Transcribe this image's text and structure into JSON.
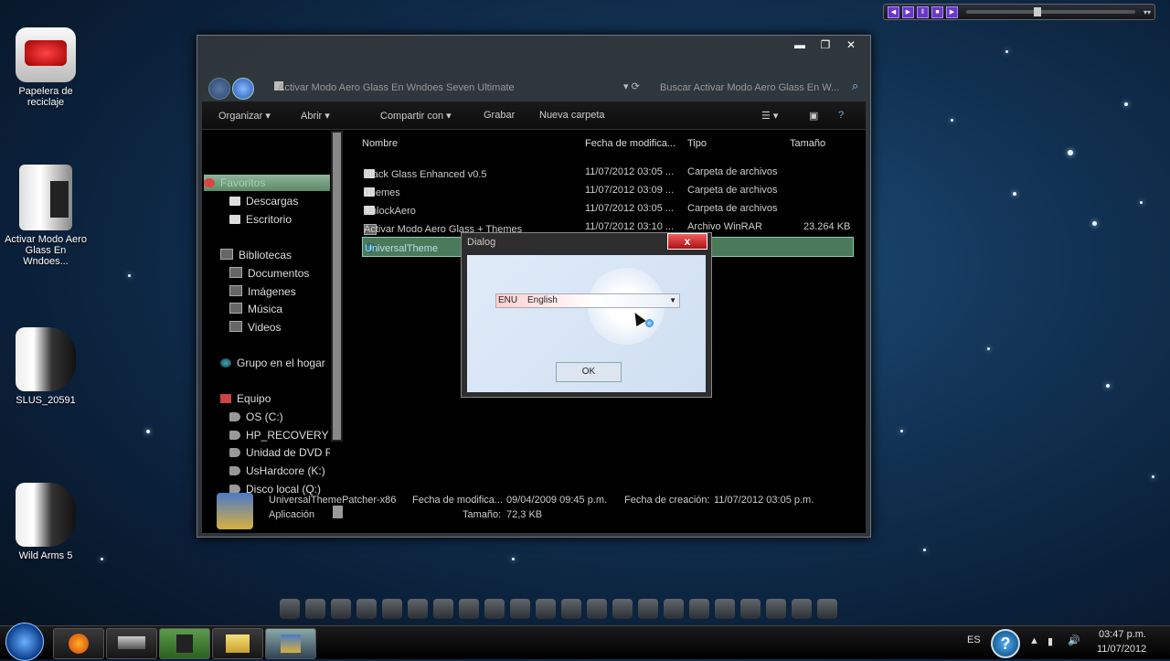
{
  "desktop": {
    "icons": [
      {
        "label": "Papelera de reciclaje",
        "icon": "recycle-bin-icon"
      },
      {
        "label": "Activar Modo Aero Glass En Wndoes...",
        "icon": "winrar-archive-icon"
      },
      {
        "label": "SLUS_20591",
        "icon": "disc-drive-icon"
      },
      {
        "label": "Wild Arms 5",
        "icon": "disc-drive-icon"
      }
    ]
  },
  "explorer": {
    "address": "Activar Modo Aero Glass En Wndoes Seven Ultimate",
    "search_placeholder": "Buscar Activar Modo Aero Glass En W...",
    "toolbar": {
      "organize": "Organizar",
      "open": "Abrir",
      "share": "Compartir con",
      "burn": "Grabar",
      "new_folder": "Nueva carpeta"
    },
    "nav": {
      "favorites": "Favoritos",
      "downloads": "Descargas",
      "desktop": "Escritorio",
      "libraries": "Bibliotecas",
      "documents": "Documentos",
      "images": "Imágenes",
      "music": "Música",
      "videos": "Videos",
      "homegroup": "Grupo en el hogar",
      "computer": "Equipo",
      "os": "OS (C:)",
      "recovery": "HP_RECOVERY (D",
      "dvd": "Unidad de DVD R",
      "ushardcore": "UsHardcore (K:)",
      "local_q": "Disco local (Q:)"
    },
    "columns": {
      "name": "Nombre",
      "modified": "Fecha de modifica...",
      "type": "Tipo",
      "size": "Tamaño"
    },
    "files": [
      {
        "name": "Black Glass Enhanced v0.5",
        "modified": "11/07/2012 03:05 ...",
        "type": "Carpeta de archivos",
        "size": ""
      },
      {
        "name": "Themes",
        "modified": "11/07/2012 03:09 ...",
        "type": "Carpeta de archivos",
        "size": ""
      },
      {
        "name": "UnlockAero",
        "modified": "11/07/2012 03:05 ...",
        "type": "Carpeta de archivos",
        "size": ""
      },
      {
        "name": "Activar Modo Aero Glass + Themes",
        "modified": "11/07/2012 03:10 ...",
        "type": "Archivo WinRAR",
        "size": "23.264 KB"
      },
      {
        "name": "UniversalTheme",
        "modified": "",
        "type": "",
        "size": ""
      }
    ],
    "details": {
      "filename": "UniversalThemePatcher-x86",
      "modified_label": "Fecha de modifica...",
      "modified_value": "09/04/2009 09:45 p.m.",
      "created_label": "Fecha de creación:",
      "created_value": "11/07/2012 03:05 p.m.",
      "kind": "Aplicación",
      "size_label": "Tamaño:",
      "size_value": "72,3 KB"
    }
  },
  "dialog": {
    "title": "Dialog",
    "close": "x",
    "language_code": "ENU",
    "language_name": "English",
    "ok": "OK"
  },
  "taskbar": {
    "lang": "ES",
    "time": "03:47 p.m.",
    "date": "11/07/2012"
  }
}
